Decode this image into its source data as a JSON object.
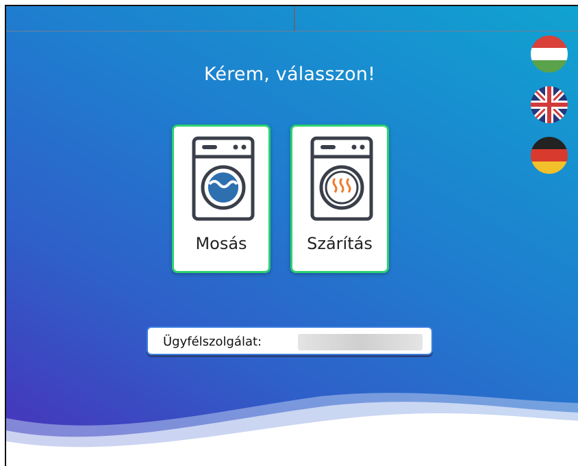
{
  "prompt_title": "Kérem, válasszon!",
  "languages": [
    {
      "code": "hu",
      "icon": "hungary-flag-icon"
    },
    {
      "code": "en",
      "icon": "uk-flag-icon"
    },
    {
      "code": "de",
      "icon": "germany-flag-icon"
    }
  ],
  "options": [
    {
      "label": "Mosás",
      "icon": "washing-machine-icon"
    },
    {
      "label": "Szárítás",
      "icon": "dryer-icon"
    }
  ],
  "customer_service": {
    "label": "Ügyfélszolgálat:",
    "value": ""
  },
  "colors": {
    "card_border": "#2bd26f",
    "service_border": "#3c7fe0",
    "text": "#ffffff"
  }
}
